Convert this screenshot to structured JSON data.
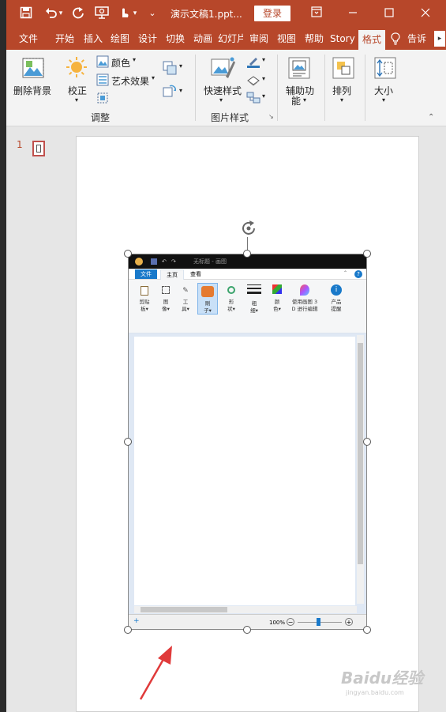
{
  "titlebar": {
    "doc_title": "演示文稿1.ppt...",
    "login": "登录",
    "bg_color": "#b7472a"
  },
  "tabs": [
    {
      "label": "文件"
    },
    {
      "label": "开始"
    },
    {
      "label": "插入"
    },
    {
      "label": "绘图"
    },
    {
      "label": "设计"
    },
    {
      "label": "切换"
    },
    {
      "label": "动画"
    },
    {
      "label": "幻灯片"
    },
    {
      "label": "审阅"
    },
    {
      "label": "视图"
    },
    {
      "label": "帮助"
    },
    {
      "label": "Story"
    },
    {
      "label": "格式",
      "active": true
    },
    {
      "label": "告诉"
    }
  ],
  "ribbon": {
    "remove_bg": "删除背景",
    "correct": "校正",
    "color": "颜色",
    "art_effects": "艺术效果",
    "group_adjust": "调整",
    "quick_styles": "快速样式",
    "group_picture_styles": "图片样式",
    "accessibility": "辅助功",
    "accessibility_2": "能",
    "arrange": "排列",
    "size": "大小"
  },
  "thumbnails": {
    "slide_number": "1"
  },
  "paint": {
    "title": "无标题 - 画图",
    "tab_file": "文件",
    "tab_home": "主页",
    "tab_view": "查看",
    "tools": [
      {
        "l1": "剪贴",
        "l2": "板▾"
      },
      {
        "l1": "图",
        "l2": "像▾"
      },
      {
        "l1": "工",
        "l2": "具▾"
      },
      {
        "l1": "刷",
        "l2": "子▾"
      },
      {
        "l1": "形",
        "l2": "状▾"
      },
      {
        "l1": "粗",
        "l2": "细▾"
      },
      {
        "l1": "颜",
        "l2": "色▾"
      },
      {
        "l1": "使用画图 3",
        "l2": "D 进行编辑"
      },
      {
        "l1": "产品",
        "l2": "提醒"
      }
    ],
    "zoom": "100%"
  },
  "watermark": {
    "brand": "Baidu经验",
    "url": "jingyan.baidu.com"
  }
}
